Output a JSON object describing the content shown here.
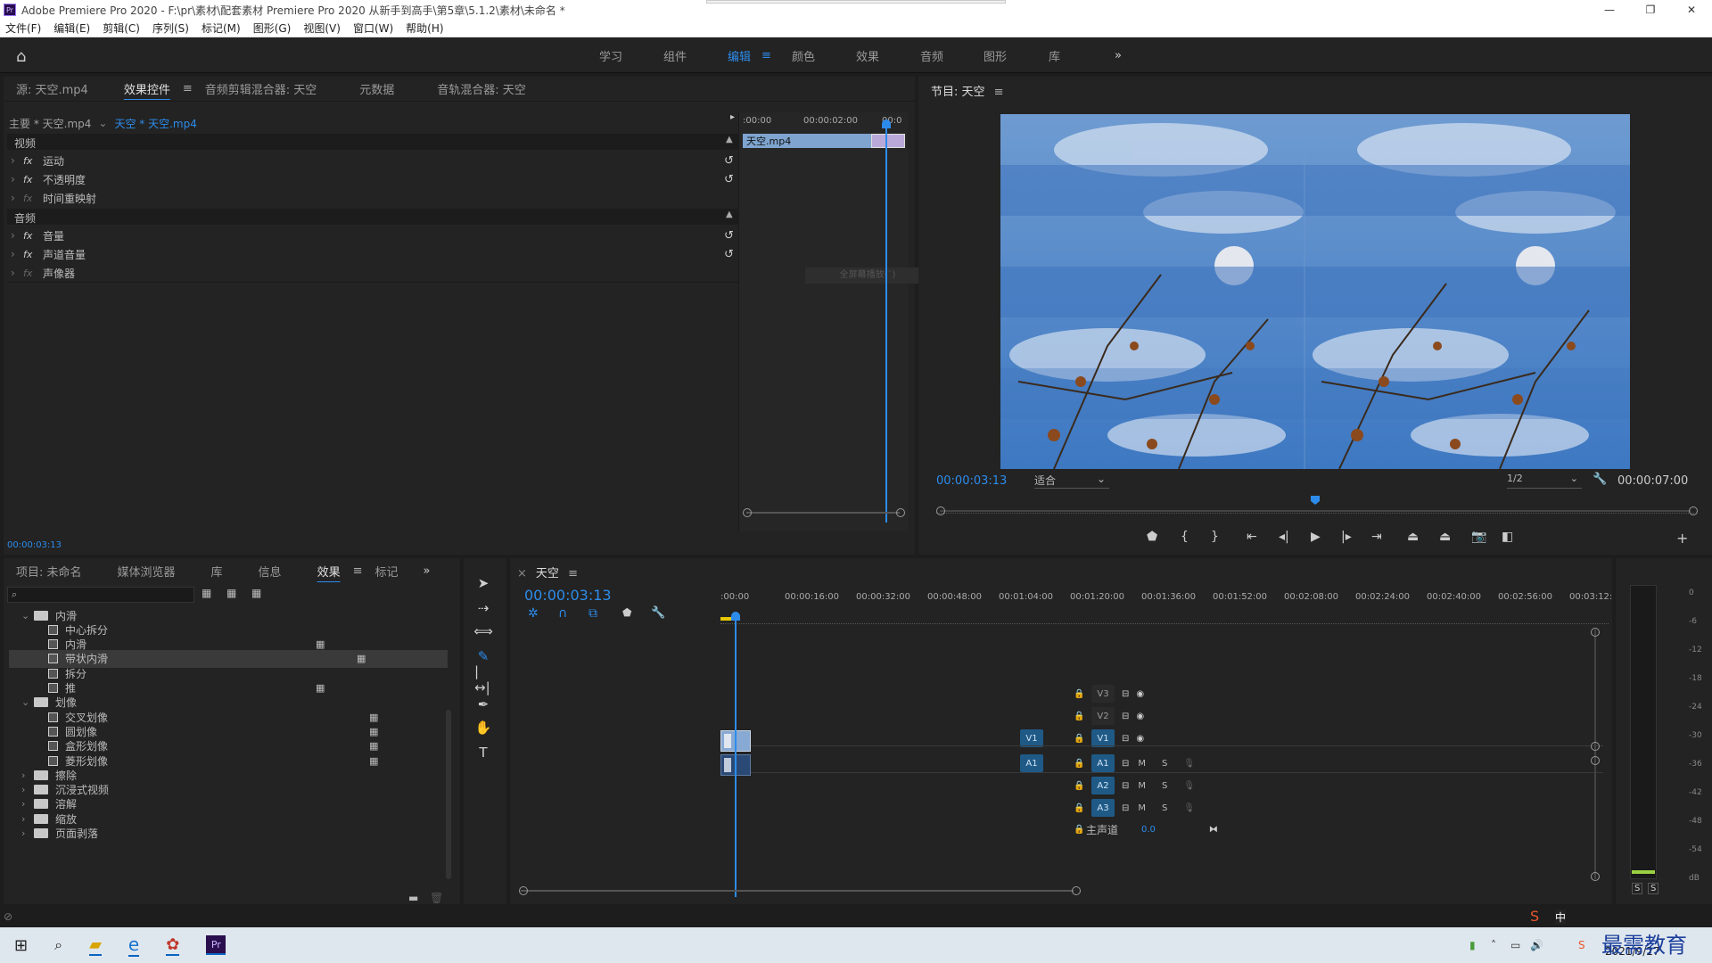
{
  "window": {
    "title": "Adobe Premiere Pro 2020 - F:\\pr\\素材\\配套素材 Premiere Pro 2020 从新手到高手\\第5章\\5.1.2\\素材\\未命名 *",
    "app_icon": "Pr",
    "minimize": "—",
    "maximize": "❐",
    "close": "✕"
  },
  "menu": [
    "文件(F)",
    "编辑(E)",
    "剪辑(C)",
    "序列(S)",
    "标记(M)",
    "图形(G)",
    "视图(V)",
    "窗口(W)",
    "帮助(H)"
  ],
  "workspaces": [
    {
      "label": "学习"
    },
    {
      "label": "组件"
    },
    {
      "label": "编辑",
      "active": true
    },
    {
      "label": "颜色"
    },
    {
      "label": "效果"
    },
    {
      "label": "音频"
    },
    {
      "label": "图形"
    },
    {
      "label": "库"
    }
  ],
  "workspace_more": "»",
  "effect_controls": {
    "tabs": [
      "源: 天空.mp4",
      "效果控件",
      "音频剪辑混合器: 天空",
      "元数据",
      "音轨混合器: 天空"
    ],
    "master": "主要 * 天空.mp4",
    "clip": "天空 * 天空.mp4",
    "video_section": "视频",
    "audio_section": "音频",
    "video_effects": [
      {
        "name": "运动",
        "fx": "fx"
      },
      {
        "name": "不透明度",
        "fx": "fx"
      },
      {
        "name": "时间重映射",
        "fx": "fx"
      }
    ],
    "audio_effects": [
      {
        "name": "音量",
        "fx": "fx"
      },
      {
        "name": "声道音量",
        "fx": "fx"
      },
      {
        "name": "声像器",
        "fx": "fx"
      }
    ],
    "mini_timeline": {
      "t0": ":00:00",
      "t1": "00:00:02:00",
      "t2": "00:0",
      "clip_label": "天空.mp4",
      "ghost": "全屏幕播放(`)"
    },
    "timecode": "00:00:03:13"
  },
  "program": {
    "tab": "节目: 天空",
    "timecode": "00:00:03:13",
    "fit": "适合",
    "res": "1/2",
    "duration": "00:00:07:00",
    "playhead_fraction": 0.5
  },
  "project": {
    "tabs": [
      "项目: 未命名",
      "媒体浏览器",
      "库",
      "信息",
      "效果",
      "标记"
    ],
    "more": "»",
    "items": [
      {
        "type": "folder",
        "label": "内滑",
        "open": true,
        "level": 0
      },
      {
        "type": "item",
        "label": "中心拆分",
        "level": 1,
        "badge": ""
      },
      {
        "type": "item",
        "label": "内滑",
        "level": 1,
        "badge": "▦"
      },
      {
        "type": "item",
        "label": "带状内滑",
        "level": 1,
        "badge": "▦",
        "selected": true
      },
      {
        "type": "item",
        "label": "拆分",
        "level": 1,
        "badge": ""
      },
      {
        "type": "item",
        "label": "推",
        "level": 1,
        "badge": "▦"
      },
      {
        "type": "folder",
        "label": "划像",
        "open": true,
        "level": 0
      },
      {
        "type": "item",
        "label": "交叉划像",
        "level": 1,
        "badge": "▦"
      },
      {
        "type": "item",
        "label": "圆划像",
        "level": 1,
        "badge": "▦"
      },
      {
        "type": "item",
        "label": "盒形划像",
        "level": 1,
        "badge": "▦"
      },
      {
        "type": "item",
        "label": "菱形划像",
        "level": 1,
        "badge": "▦"
      },
      {
        "type": "folder",
        "label": "擦除",
        "open": false,
        "level": 0
      },
      {
        "type": "folder",
        "label": "沉浸式视频",
        "open": false,
        "level": 0
      },
      {
        "type": "folder",
        "label": "溶解",
        "open": false,
        "level": 0
      },
      {
        "type": "folder",
        "label": "缩放",
        "open": false,
        "level": 0
      },
      {
        "type": "folder",
        "label": "页面剥落",
        "open": false,
        "level": 0
      }
    ]
  },
  "timeline": {
    "tab": "天空",
    "timecode": "00:00:03:13",
    "ruler": [
      ":00:00",
      "00:00:16:00",
      "00:00:32:00",
      "00:00:48:00",
      "00:01:04:00",
      "00:01:20:00",
      "00:01:36:00",
      "00:01:52:00",
      "00:02:08:00",
      "00:02:24:00",
      "00:02:40:00",
      "00:02:56:00",
      "00:03:12:"
    ],
    "video_tracks": [
      "V3",
      "V2",
      "V1"
    ],
    "audio_tracks": [
      "A1",
      "A2",
      "A3"
    ],
    "src_v": "V1",
    "src_a": "A1",
    "master": "主声道",
    "master_val": "0.0",
    "m": "M",
    "s": "S"
  },
  "meter": {
    "ticks": [
      "0",
      "-6",
      "-12",
      "-18",
      "-24",
      "-30",
      "-36",
      "-42",
      "-48",
      "-54",
      "dB"
    ],
    "s": "S"
  },
  "taskbar": {
    "date": "2021/9/27",
    "ime": "中",
    "watermark": "最需教育"
  }
}
